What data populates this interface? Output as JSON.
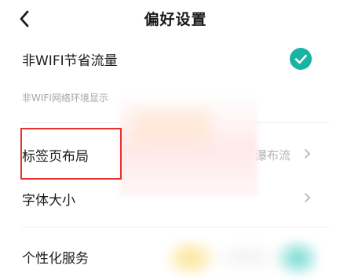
{
  "header": {
    "title": "偏好设置",
    "back_icon": "chevron-left-icon"
  },
  "settings": {
    "non_wifi_saving": {
      "label": "非WIFI节省流量",
      "enabled": true,
      "description": "非WIFI网络环境显示",
      "toggle_color": "#17b3a3"
    },
    "tab_layout": {
      "label": "标签页布局",
      "value": "瀑布流"
    },
    "font_size": {
      "label": "字体大小"
    },
    "personalized_service": {
      "label": "个性化服务"
    }
  },
  "annotation": {
    "highlight_color": "#e8302a"
  }
}
